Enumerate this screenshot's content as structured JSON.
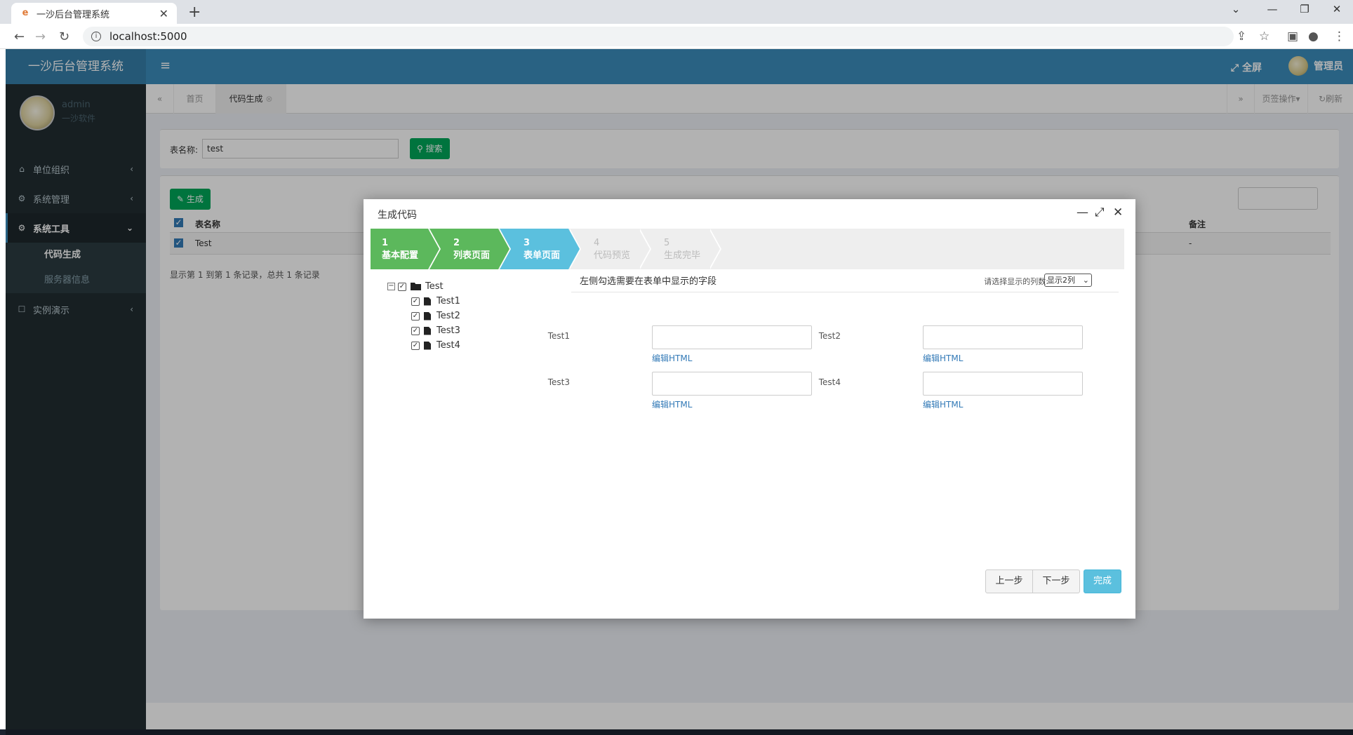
{
  "browser": {
    "tab_title": "一沙后台管理系统",
    "url": "localhost:5000"
  },
  "app": {
    "brand": "一沙后台管理系统",
    "fullscreen_label": "全屏",
    "user_label": "管理员"
  },
  "sidebar": {
    "user_name": "admin",
    "user_org": "一沙软件",
    "items": [
      {
        "label": "单位组织"
      },
      {
        "label": "系统管理"
      },
      {
        "label": "系统工具"
      },
      {
        "label": "实例演示"
      }
    ],
    "subitems": [
      {
        "label": "代码生成"
      },
      {
        "label": "服务器信息"
      }
    ]
  },
  "tabs": {
    "home": "首页",
    "current": "代码生成",
    "page_ops": "页签操作",
    "refresh": "刷新"
  },
  "search": {
    "label": "表名称:",
    "value": "test",
    "button": "搜索"
  },
  "table": {
    "generate_button": "生成",
    "headers": {
      "name": "表名称",
      "remark": "备注"
    },
    "row": {
      "name": "Test",
      "remark": "-"
    },
    "pagination": "显示第 1 到第 1 条记录，总共 1 条记录"
  },
  "dialog": {
    "title": "生成代码",
    "steps": [
      {
        "num": "1",
        "label": "基本配置"
      },
      {
        "num": "2",
        "label": "列表页面"
      },
      {
        "num": "3",
        "label": "表单页面"
      },
      {
        "num": "4",
        "label": "代码预览"
      },
      {
        "num": "5",
        "label": "生成完毕"
      }
    ],
    "tree": {
      "root": "Test",
      "children": [
        "Test1",
        "Test2",
        "Test3",
        "Test4"
      ]
    },
    "right_title": "左侧勾选需要在表单中显示的字段",
    "columns_label": "请选择显示的列数:",
    "columns_value": "显示2列",
    "fields": [
      {
        "label": "Test1",
        "link": "编辑HTML"
      },
      {
        "label": "Test2",
        "link": "编辑HTML"
      },
      {
        "label": "Test3",
        "link": "编辑HTML"
      },
      {
        "label": "Test4",
        "link": "编辑HTML"
      }
    ],
    "buttons": {
      "prev": "上一步",
      "next": "下一步",
      "finish": "完成"
    }
  },
  "colors": {
    "header": "#3c8dbc",
    "sidebar": "#222d32",
    "step_done": "#5cb85c",
    "step_current": "#5bc0de",
    "primary_green": "#00a65a",
    "finish_button": "#5bc0de"
  }
}
